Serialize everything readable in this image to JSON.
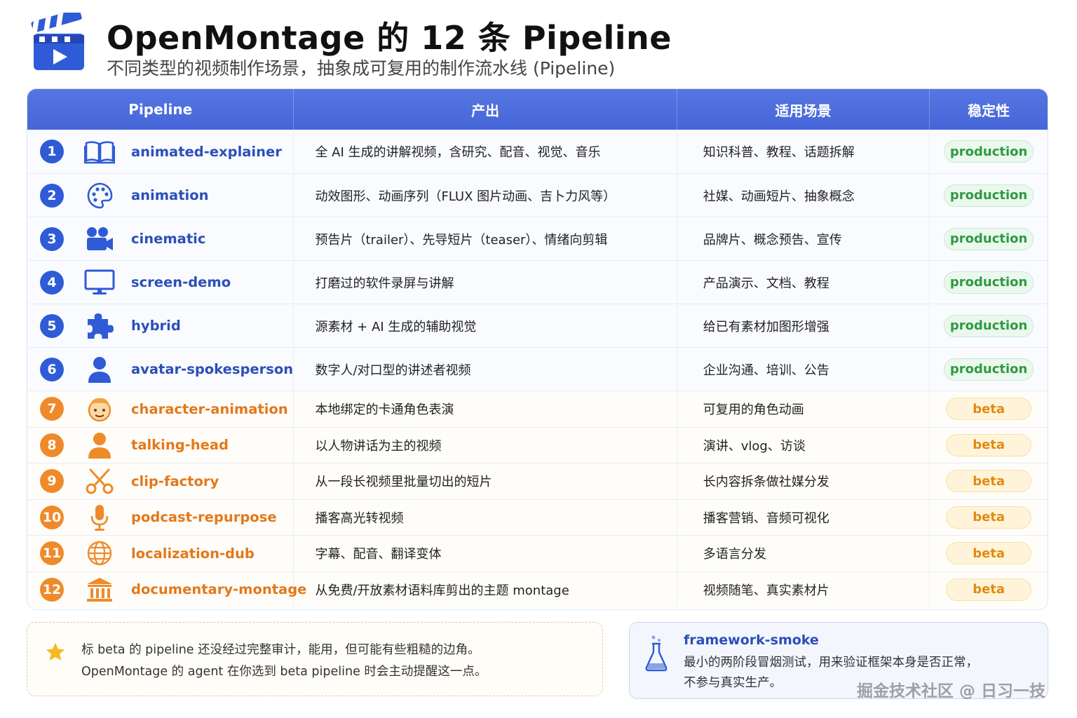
{
  "header": {
    "title": "OpenMontage 的 12 条 Pipeline",
    "subtitle": "不同类型的视频制作场景，抽象成可复用的制作流水线 (Pipeline)"
  },
  "table": {
    "columns": [
      "Pipeline",
      "产出",
      "适用场景",
      "稳定性"
    ],
    "rows": [
      {
        "num": "1",
        "icon": "book-icon",
        "name": "animated-explainer",
        "output": "全 AI 生成的讲解视频，含研究、配音、视觉、音乐",
        "scene": "知识科普、教程、话题拆解",
        "stability": "production"
      },
      {
        "num": "2",
        "icon": "palette-icon",
        "name": "animation",
        "output": "动效图形、动画序列（FLUX 图片动画、吉卜力风等）",
        "scene": "社媒、动画短片、抽象概念",
        "stability": "production"
      },
      {
        "num": "3",
        "icon": "movie-camera-icon",
        "name": "cinematic",
        "output": "预告片（trailer）、先导短片（teaser）、情绪向剪辑",
        "scene": "品牌片、概念预告、宣传",
        "stability": "production"
      },
      {
        "num": "4",
        "icon": "monitor-icon",
        "name": "screen-demo",
        "output": "打磨过的软件录屏与讲解",
        "scene": "产品演示、文档、教程",
        "stability": "production"
      },
      {
        "num": "5",
        "icon": "puzzle-icon",
        "name": "hybrid",
        "output": "源素材 + AI 生成的辅助视觉",
        "scene": "给已有素材加图形增强",
        "stability": "production"
      },
      {
        "num": "6",
        "icon": "person-icon",
        "name": "avatar-spokesperson",
        "output": "数字人/对口型的讲述者视频",
        "scene": "企业沟通、培训、公告",
        "stability": "production"
      },
      {
        "num": "7",
        "icon": "cartoon-face-icon",
        "name": "character-animation",
        "output": "本地绑定的卡通角色表演",
        "scene": "可复用的角色动画",
        "stability": "beta"
      },
      {
        "num": "8",
        "icon": "speaker-person-icon",
        "name": "talking-head",
        "output": "以人物讲话为主的视频",
        "scene": "演讲、vlog、访谈",
        "stability": "beta"
      },
      {
        "num": "9",
        "icon": "scissors-icon",
        "name": "clip-factory",
        "output": "从一段长视频里批量切出的短片",
        "scene": "长内容拆条做社媒分发",
        "stability": "beta"
      },
      {
        "num": "10",
        "icon": "microphone-icon",
        "name": "podcast-repurpose",
        "output": "播客高光转视频",
        "scene": "播客营销、音频可视化",
        "stability": "beta"
      },
      {
        "num": "11",
        "icon": "globe-icon",
        "name": "localization-dub",
        "output": "字幕、配音、翻译变体",
        "scene": "多语言分发",
        "stability": "beta"
      },
      {
        "num": "12",
        "icon": "museum-icon",
        "name": "documentary-montage",
        "output": "从免费/开放素材语料库剪出的主题 montage",
        "scene": "视频随笔、真实素材片",
        "stability": "beta"
      }
    ]
  },
  "note": {
    "line1": "标 beta 的 pipeline 还没经过完整审计，能用，但可能有些粗糙的边角。",
    "line2": "OpenMontage 的 agent 在你选到 beta pipeline 时会主动提醒这一点。"
  },
  "smoke": {
    "title": "framework-smoke",
    "line1": "最小的两阶段冒烟测试，用来验证框架本身是否正常，",
    "line2": "不参与真实生产。"
  },
  "watermark": "掘金技术社区 @ 日习一技",
  "colors": {
    "primary": "#4666d8",
    "production": "#2f9a3f",
    "beta": "#e28a0f",
    "orange": "#ef8a2a"
  }
}
